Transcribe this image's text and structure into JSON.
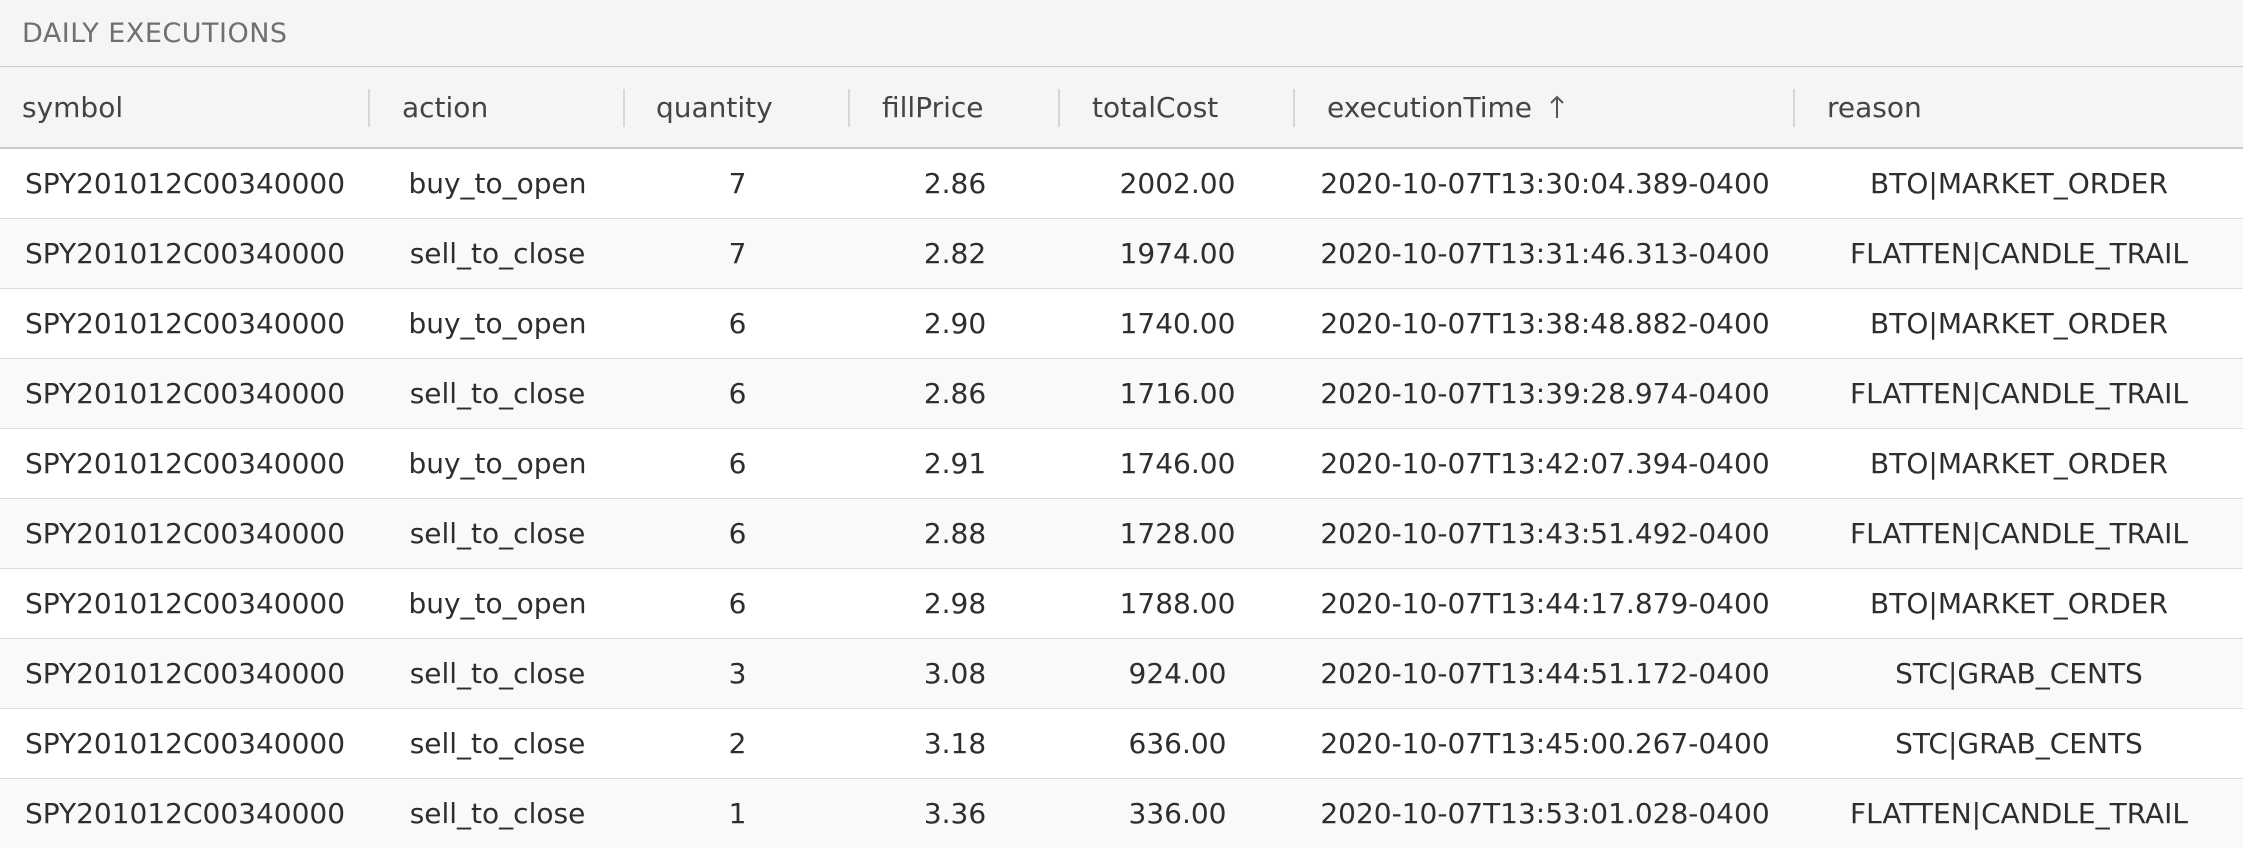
{
  "panel": {
    "title": "DAILY EXECUTIONS"
  },
  "table": {
    "columns": [
      {
        "key": "symbol",
        "label": "symbol"
      },
      {
        "key": "action",
        "label": "action"
      },
      {
        "key": "quantity",
        "label": "quantity"
      },
      {
        "key": "fillPrice",
        "label": "fillPrice"
      },
      {
        "key": "totalCost",
        "label": "totalCost"
      },
      {
        "key": "executionTime",
        "label": "executionTime",
        "sort": "ascending",
        "sort_icon": "arrow-up-icon"
      },
      {
        "key": "reason",
        "label": "reason"
      }
    ],
    "rows": [
      {
        "symbol": "SPY201012C00340000",
        "action": "buy_to_open",
        "quantity": "7",
        "fillPrice": "2.86",
        "totalCost": "2002.00",
        "executionTime": "2020-10-07T13:30:04.389-0400",
        "reason": "BTO|MARKET_ORDER"
      },
      {
        "symbol": "SPY201012C00340000",
        "action": "sell_to_close",
        "quantity": "7",
        "fillPrice": "2.82",
        "totalCost": "1974.00",
        "executionTime": "2020-10-07T13:31:46.313-0400",
        "reason": "FLATTEN|CANDLE_TRAIL"
      },
      {
        "symbol": "SPY201012C00340000",
        "action": "buy_to_open",
        "quantity": "6",
        "fillPrice": "2.90",
        "totalCost": "1740.00",
        "executionTime": "2020-10-07T13:38:48.882-0400",
        "reason": "BTO|MARKET_ORDER"
      },
      {
        "symbol": "SPY201012C00340000",
        "action": "sell_to_close",
        "quantity": "6",
        "fillPrice": "2.86",
        "totalCost": "1716.00",
        "executionTime": "2020-10-07T13:39:28.974-0400",
        "reason": "FLATTEN|CANDLE_TRAIL"
      },
      {
        "symbol": "SPY201012C00340000",
        "action": "buy_to_open",
        "quantity": "6",
        "fillPrice": "2.91",
        "totalCost": "1746.00",
        "executionTime": "2020-10-07T13:42:07.394-0400",
        "reason": "BTO|MARKET_ORDER"
      },
      {
        "symbol": "SPY201012C00340000",
        "action": "sell_to_close",
        "quantity": "6",
        "fillPrice": "2.88",
        "totalCost": "1728.00",
        "executionTime": "2020-10-07T13:43:51.492-0400",
        "reason": "FLATTEN|CANDLE_TRAIL"
      },
      {
        "symbol": "SPY201012C00340000",
        "action": "buy_to_open",
        "quantity": "6",
        "fillPrice": "2.98",
        "totalCost": "1788.00",
        "executionTime": "2020-10-07T13:44:17.879-0400",
        "reason": "BTO|MARKET_ORDER"
      },
      {
        "symbol": "SPY201012C00340000",
        "action": "sell_to_close",
        "quantity": "3",
        "fillPrice": "3.08",
        "totalCost": "924.00",
        "executionTime": "2020-10-07T13:44:51.172-0400",
        "reason": "STC|GRAB_CENTS"
      },
      {
        "symbol": "SPY201012C00340000",
        "action": "sell_to_close",
        "quantity": "2",
        "fillPrice": "3.18",
        "totalCost": "636.00",
        "executionTime": "2020-10-07T13:45:00.267-0400",
        "reason": "STC|GRAB_CENTS"
      },
      {
        "symbol": "SPY201012C00340000",
        "action": "sell_to_close",
        "quantity": "1",
        "fillPrice": "3.36",
        "totalCost": "336.00",
        "executionTime": "2020-10-07T13:53:01.028-0400",
        "reason": "FLATTEN|CANDLE_TRAIL"
      }
    ]
  }
}
